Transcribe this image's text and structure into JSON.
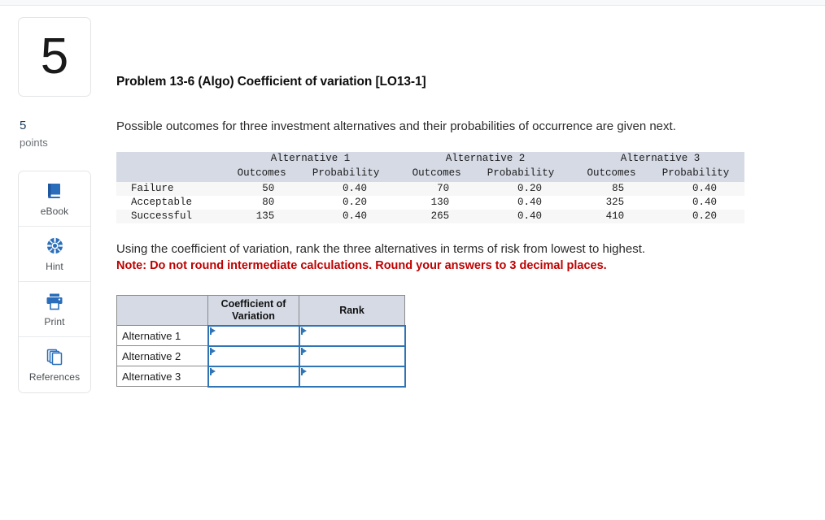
{
  "question": {
    "number": "5",
    "points_value": "5",
    "points_label": "points"
  },
  "tools": [
    {
      "name": "ebook",
      "label": "eBook",
      "icon": "book-icon"
    },
    {
      "name": "hint",
      "label": "Hint",
      "icon": "lifebuoy-icon"
    },
    {
      "name": "print",
      "label": "Print",
      "icon": "printer-icon"
    },
    {
      "name": "references",
      "label": "References",
      "icon": "copy-pages-icon"
    }
  ],
  "problem": {
    "title": "Problem 13-6 (Algo) Coefficient of variation [LO13-1]",
    "lead": "Possible outcomes for three investment alternatives and their probabilities of occurrence are given next.",
    "instruction": "Using the coefficient of variation, rank the three alternatives in terms of risk from lowest to highest.",
    "note": "Note: Do not round intermediate calculations. Round your answers to 3 decimal places."
  },
  "given_table": {
    "group_headers": [
      "Alternative 1",
      "Alternative 2",
      "Alternative 3"
    ],
    "sub_headers": [
      "Outcomes",
      "Probability"
    ],
    "rows": [
      {
        "label": "Failure",
        "a1_outcome": "50",
        "a1_prob": "0.40",
        "a2_outcome": "70",
        "a2_prob": "0.20",
        "a3_outcome": "85",
        "a3_prob": "0.40"
      },
      {
        "label": "Acceptable",
        "a1_outcome": "80",
        "a1_prob": "0.20",
        "a2_outcome": "130",
        "a2_prob": "0.40",
        "a3_outcome": "325",
        "a3_prob": "0.40"
      },
      {
        "label": "Successful",
        "a1_outcome": "135",
        "a1_prob": "0.40",
        "a2_outcome": "265",
        "a2_prob": "0.40",
        "a3_outcome": "410",
        "a3_prob": "0.20"
      }
    ]
  },
  "answer_table": {
    "headers": {
      "blank": "",
      "cv": "Coefficient of Variation",
      "rank": "Rank"
    },
    "rows": [
      {
        "label": "Alternative 1",
        "cv": "",
        "rank": ""
      },
      {
        "label": "Alternative 2",
        "cv": "",
        "rank": ""
      },
      {
        "label": "Alternative 3",
        "cv": "",
        "rank": ""
      }
    ]
  },
  "colors": {
    "header_fill": "#d5dae5",
    "input_border": "#2f75b5",
    "note_red": "#c00000",
    "points_blue": "#1b3a5c",
    "icon_blue": "#2a6ebb"
  }
}
